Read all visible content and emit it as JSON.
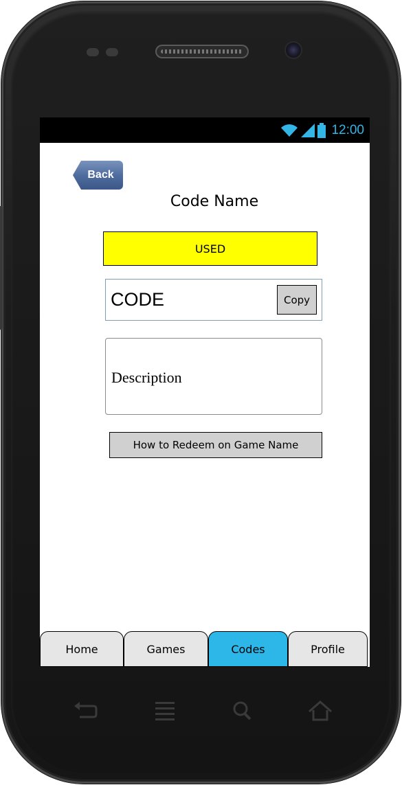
{
  "status_bar": {
    "time": "12:00",
    "accent": "#33b5e5"
  },
  "screen": {
    "back_label": "Back",
    "title": "Code Name",
    "status_badge": "USED",
    "code_value": "CODE",
    "copy_label": "Copy",
    "description": "Description",
    "howto_label": "How to Redeem on Game Name"
  },
  "tabs": [
    {
      "label": "Home",
      "active": false
    },
    {
      "label": "Games",
      "active": false
    },
    {
      "label": "Codes",
      "active": true
    },
    {
      "label": "Profile",
      "active": false
    }
  ],
  "nav_buttons": [
    "back-icon",
    "menu-icon",
    "search-icon",
    "home-icon"
  ],
  "colors": {
    "badge": "#ffff00",
    "active_tab": "#2db6e8",
    "back_button": "#4f6d9f"
  }
}
